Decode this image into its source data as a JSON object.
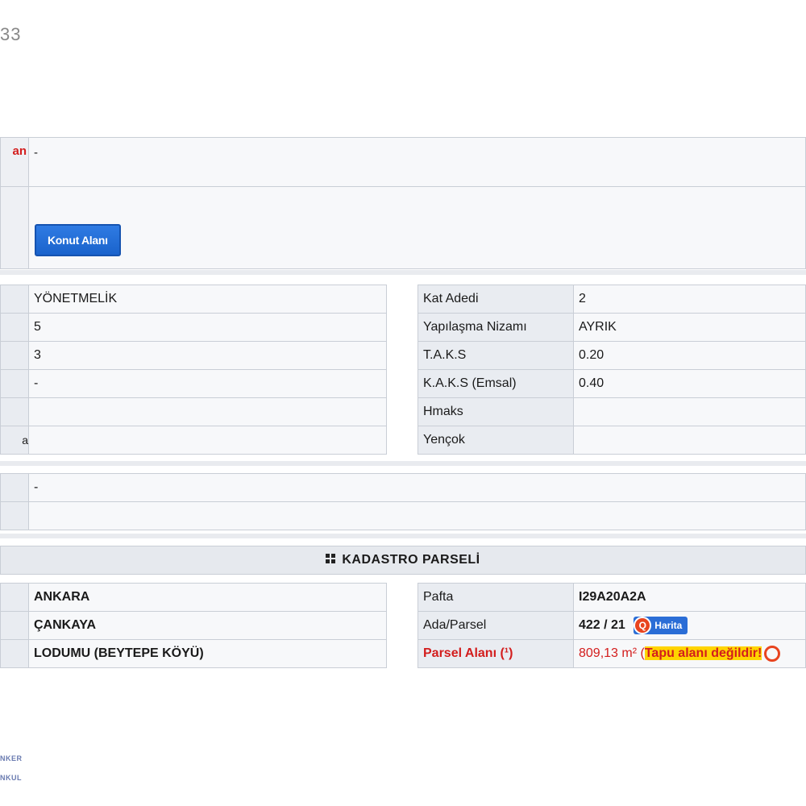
{
  "page_number": "33",
  "top": {
    "label_partial": "an",
    "value_row1": "-",
    "konut_button": "Konut Alanı"
  },
  "left_grid": [
    {
      "value": "YÖNETMELİK"
    },
    {
      "value": "5"
    },
    {
      "value": "3"
    },
    {
      "value": "-"
    },
    {
      "value": ""
    },
    {
      "value": "",
      "label_partial": "a"
    }
  ],
  "right_grid": [
    {
      "label": "Kat Adedi",
      "value": "2"
    },
    {
      "label": "Yapılaşma Nizamı",
      "value": "AYRIK"
    },
    {
      "label": "T.A.K.S",
      "value": "0.20"
    },
    {
      "label": "K.A.K.S (Emsal)",
      "value": "0.40"
    },
    {
      "label": "Hmaks",
      "value": ""
    },
    {
      "label": "Yençok",
      "value": ""
    }
  ],
  "mid_rows": [
    {
      "value": "-"
    },
    {
      "value": ""
    }
  ],
  "kadastro": {
    "header": "KADASTRO PARSELİ",
    "left": [
      {
        "value": "ANKARA"
      },
      {
        "value": "ÇANKAYA"
      },
      {
        "value": "LODUMU (BEYTEPE KÖYÜ)"
      }
    ],
    "pafta_label": "Pafta",
    "pafta_value": "I29A20A2A",
    "ada_label": "Ada/Parsel",
    "ada_value": "422 / 21",
    "harita_button": "Harita",
    "parsel_label": "Parsel Alanı (¹)",
    "parsel_value": "809,13 m²",
    "tapu_open": "(",
    "tapu_warning": "Tapu alanı değildir!"
  },
  "footer": {
    "line1": "NKER",
    "line2": "NKUL"
  },
  "colors": {
    "accent_blue": "#1a63cc",
    "warning_red": "#d31d1d",
    "warning_yellow": "#ffd400"
  }
}
